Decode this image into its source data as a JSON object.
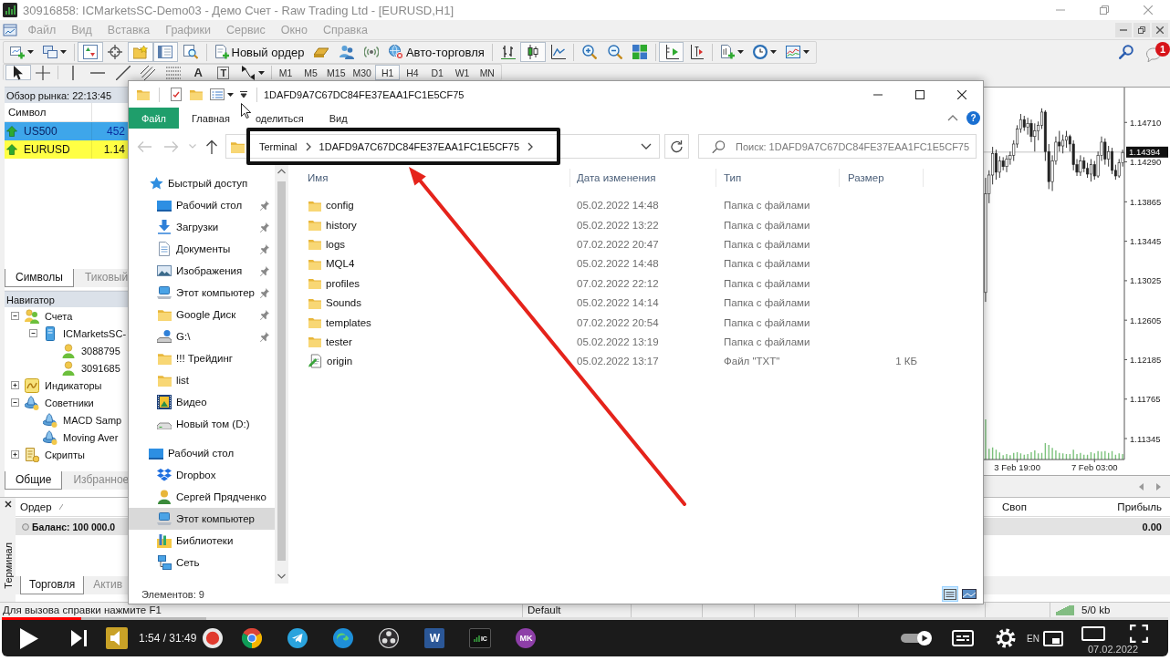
{
  "mt4": {
    "title": "30916858: ICMarketsSC-Demo03 - Демо Счет - Raw Trading Ltd - [EURUSD,H1]",
    "menu": [
      "Файл",
      "Вид",
      "Вставка",
      "Графики",
      "Сервис",
      "Окно",
      "Справка"
    ],
    "toolbar": {
      "groups": [
        [
          {
            "kind": "chart-plus",
            "pressed": false,
            "dropdown": true
          },
          {
            "kind": "windows",
            "pressed": false,
            "dropdown": true
          }
        ],
        [
          {
            "kind": "market-watch",
            "pressed": true,
            "dropdown": false
          },
          {
            "kind": "data-window",
            "pressed": false,
            "dropdown": false
          },
          {
            "kind": "navigator",
            "pressed": true,
            "dropdown": false
          },
          {
            "kind": "terminal",
            "pressed": true,
            "dropdown": false
          },
          {
            "kind": "tester",
            "pressed": false,
            "dropdown": false
          }
        ],
        [
          {
            "kind": "new-order",
            "label": "Новый ордер",
            "pressed": false,
            "dropdown": false
          },
          {
            "kind": "editor",
            "pressed": false,
            "dropdown": false
          },
          {
            "kind": "signals",
            "pressed": false,
            "dropdown": false
          },
          {
            "kind": "radio",
            "pressed": false,
            "dropdown": false
          },
          {
            "kind": "autotrading",
            "label": "Авто-торговля",
            "pressed": false,
            "dropdown": false
          }
        ],
        [
          {
            "kind": "bars",
            "pressed": false,
            "dropdown": false
          },
          {
            "kind": "candles",
            "pressed": true,
            "dropdown": false
          },
          {
            "kind": "line",
            "pressed": false,
            "dropdown": false
          }
        ],
        [
          {
            "kind": "zoom-in",
            "pressed": false,
            "dropdown": false
          },
          {
            "kind": "zoom-out",
            "pressed": false,
            "dropdown": false
          },
          {
            "kind": "tile",
            "pressed": false,
            "dropdown": false
          }
        ],
        [
          {
            "kind": "shift",
            "pressed": true,
            "dropdown": false
          },
          {
            "kind": "autoscroll",
            "pressed": false,
            "dropdown": false
          }
        ],
        [
          {
            "kind": "indicators",
            "pressed": false,
            "dropdown": true
          },
          {
            "kind": "periods",
            "pressed": false,
            "dropdown": true
          },
          {
            "kind": "templates",
            "pressed": false,
            "dropdown": true
          }
        ]
      ],
      "notifications": "1"
    },
    "drawing_toolbar": {
      "groups": [
        [
          {
            "kind": "cursor",
            "pressed": true,
            "dropdown": false
          },
          {
            "kind": "cross",
            "pressed": false,
            "dropdown": false
          }
        ],
        [
          {
            "kind": "vline",
            "pressed": false,
            "dropdown": false
          },
          {
            "kind": "hline",
            "pressed": false,
            "dropdown": false
          },
          {
            "kind": "trend",
            "pressed": false,
            "dropdown": false
          },
          {
            "kind": "channel",
            "pressed": false,
            "dropdown": false
          },
          {
            "kind": "fibo",
            "pressed": false,
            "dropdown": false
          },
          {
            "kind": "text",
            "label": "A",
            "pressed": false,
            "dropdown": false
          },
          {
            "kind": "label",
            "label": "T",
            "pressed": false,
            "dropdown": false
          },
          {
            "kind": "arrows",
            "pressed": false,
            "dropdown": true
          }
        ]
      ],
      "timeframes": [
        {
          "label": "M1",
          "selected": false
        },
        {
          "label": "M5",
          "selected": false
        },
        {
          "label": "M15",
          "selected": false
        },
        {
          "label": "M30",
          "selected": false
        },
        {
          "label": "H1",
          "selected": true
        },
        {
          "label": "H4",
          "selected": false
        },
        {
          "label": "D1",
          "selected": false
        },
        {
          "label": "W1",
          "selected": false
        },
        {
          "label": "MN",
          "selected": false
        }
      ]
    },
    "market_watch": {
      "title": "Обзор рынка: 22:13:45",
      "columns": [
        "Символ"
      ],
      "rows": [
        {
          "symbol": "US500",
          "bid": "452",
          "rising": true,
          "selected": true,
          "highlighted": false
        },
        {
          "symbol": "EURUSD",
          "bid": "1.14",
          "rising": true,
          "selected": false,
          "highlighted": true
        }
      ],
      "tabs": [
        {
          "label": "Символы",
          "selected": true
        },
        {
          "label": "Тиковый",
          "selected": false
        }
      ]
    },
    "navigator": {
      "title": "Навигатор",
      "tree": [
        {
          "label": "Счета",
          "kind": "accounts",
          "expanded": true,
          "children": [
            {
              "label": "ICMarketsSC-",
              "kind": "server",
              "expanded": true,
              "children": [
                {
                  "label": "3088795",
                  "kind": "account"
                },
                {
                  "label": "3091685",
                  "kind": "account"
                }
              ]
            }
          ]
        },
        {
          "label": "Индикаторы",
          "kind": "indicators",
          "expanded": false
        },
        {
          "label": "Советники",
          "kind": "experts",
          "expanded": true,
          "children": [
            {
              "label": "MACD Samp",
              "kind": "expert"
            },
            {
              "label": "Moving Aver",
              "kind": "expert"
            }
          ]
        },
        {
          "label": "Скрипты",
          "kind": "scripts",
          "expanded": false
        }
      ],
      "tabs": [
        {
          "label": "Общие",
          "selected": true
        },
        {
          "label": "Избранное",
          "selected": false
        }
      ]
    },
    "chart": {
      "chart_data": [
        {
          "type": "candlestick",
          "categories": [
            null,
            null,
            null,
            null,
            null,
            null,
            null,
            null,
            null,
            "3 Feb 19:00",
            null,
            null,
            null,
            null,
            null,
            null,
            null,
            null,
            null,
            null,
            null,
            null,
            null,
            null,
            null,
            null,
            null,
            null,
            null,
            null,
            null,
            "7 Feb 03:00",
            null,
            null,
            null,
            null,
            null,
            null,
            null,
            null
          ],
          "ohlc": [
            [
              1.129,
              1.1412,
              1.128,
              1.1395
            ],
            [
              1.1395,
              1.142,
              1.1385,
              1.1415
            ],
            [
              1.1415,
              1.1445,
              1.1405,
              1.1438
            ],
            [
              1.1438,
              1.1442,
              1.141,
              1.1418
            ],
            [
              1.1418,
              1.1435,
              1.1412,
              1.143
            ],
            [
              1.143,
              1.1434,
              1.142,
              1.1424
            ],
            [
              1.1424,
              1.1436,
              1.1418,
              1.1432
            ],
            [
              1.1432,
              1.144,
              1.1426,
              1.1436
            ],
            [
              1.1436,
              1.1452,
              1.143,
              1.1448
            ],
            [
              1.1448,
              1.1468,
              1.1444,
              1.1464
            ],
            [
              1.1464,
              1.148,
              1.146,
              1.1474
            ],
            [
              1.1474,
              1.1478,
              1.1462,
              1.1466
            ],
            [
              1.1466,
              1.1476,
              1.1458,
              1.147
            ],
            [
              1.147,
              1.1474,
              1.145,
              1.1456
            ],
            [
              1.1456,
              1.147,
              1.144,
              1.1462
            ],
            [
              1.1462,
              1.1472,
              1.1452,
              1.1468
            ],
            [
              1.1468,
              1.1486,
              1.1464,
              1.1482
            ],
            [
              1.1482,
              1.1484,
              1.143,
              1.144
            ],
            [
              1.144,
              1.1448,
              1.14,
              1.1408
            ],
            [
              1.1408,
              1.1436,
              1.1398,
              1.143
            ],
            [
              1.143,
              1.1456,
              1.1426,
              1.145
            ],
            [
              1.145,
              1.1462,
              1.144,
              1.1446
            ],
            [
              1.1446,
              1.1458,
              1.1438,
              1.1452
            ],
            [
              1.1452,
              1.1462,
              1.1444,
              1.1456
            ],
            [
              1.1456,
              1.1458,
              1.144,
              1.1448
            ],
            [
              1.1448,
              1.1452,
              1.142,
              1.1426
            ],
            [
              1.1426,
              1.1432,
              1.1414,
              1.1418
            ],
            [
              1.1418,
              1.1436,
              1.1414,
              1.143
            ],
            [
              1.143,
              1.1434,
              1.1418,
              1.1422
            ],
            [
              1.1422,
              1.1428,
              1.1412,
              1.1416
            ],
            [
              1.1416,
              1.1432,
              1.1408,
              1.1426
            ],
            [
              1.1426,
              1.143,
              1.141,
              1.1414
            ],
            [
              1.1414,
              1.144,
              1.1412,
              1.1436
            ],
            [
              1.1436,
              1.1456,
              1.143,
              1.145
            ],
            [
              1.145,
              1.1454,
              1.1426,
              1.1432
            ],
            [
              1.1432,
              1.1446,
              1.1424,
              1.144
            ],
            [
              1.144,
              1.1444,
              1.1416,
              1.142
            ],
            [
              1.142,
              1.1426,
              1.141,
              1.1414
            ],
            [
              1.1414,
              1.1432,
              1.1412,
              1.1428
            ],
            [
              1.1428,
              1.1442,
              1.1424,
              1.1439
            ]
          ],
          "ylim": [
            1.11122,
            1.15062
          ],
          "yticks": [
            {
              "value": 1.1471,
              "label": "1.14710"
            },
            {
              "value": 1.1429,
              "label": "1.14290"
            },
            {
              "value": 1.13865,
              "label": "1.13865"
            },
            {
              "value": 1.13445,
              "label": "1.13445"
            },
            {
              "value": 1.13025,
              "label": "1.13025"
            },
            {
              "value": 1.12605,
              "label": "1.12605"
            },
            {
              "value": 1.12185,
              "label": "1.12185"
            },
            {
              "value": 1.11765,
              "label": "1.11765"
            },
            {
              "value": 1.11345,
              "label": "1.11345"
            }
          ],
          "ref_lines": [
            {
              "axis": "y",
              "value": 1.14394,
              "label": "1.14394",
              "color": "#b4b4b4"
            }
          ]
        }
      ]
    },
    "terminal": {
      "title": "Терминал",
      "columns": [
        "Ордер",
        "Своп",
        "Прибыль"
      ],
      "balance": {
        "label": "Баланс: 100 000.0",
        "profit": "0.00"
      },
      "tabs": [
        {
          "label": "Торговля",
          "selected": true
        },
        {
          "label": "Актив",
          "selected": false
        }
      ]
    },
    "status_bar": {
      "help": "Для вызова справки нажмите F1",
      "profile": "Default",
      "traffic": "5/0 kb"
    }
  },
  "explorer": {
    "title": "1DAFD9A7C67DC84FE37EAA1FC1E5CF75",
    "ribbon": [
      {
        "kind": "menu",
        "label": "Файл"
      },
      {
        "kind": "tab",
        "label": "Главная"
      },
      {
        "kind": "tab",
        "label": "оделиться"
      },
      {
        "kind": "tab",
        "label": "Вид"
      }
    ],
    "help": "?",
    "nav_buttons": [
      {
        "kind": "back",
        "disabled": true
      },
      {
        "kind": "forward",
        "disabled": true
      },
      {
        "kind": "recent",
        "disabled": true
      },
      {
        "kind": "up",
        "disabled": false
      }
    ],
    "address": [
      "Terminal",
      "1DAFD9A7C67DC84FE37EAA1FC1E5CF75"
    ],
    "search": {
      "placeholder": "Поиск: 1DAFD9A7C67DC84FE37EAA1FC1E5CF75"
    },
    "nav": [
      {
        "label": "Быстрый доступ",
        "kind": "star",
        "selected": false,
        "children": [
          {
            "label": "Рабочий стол",
            "kind": "desktop",
            "pinned": true,
            "selected": false
          },
          {
            "label": "Загрузки",
            "kind": "downloads",
            "pinned": true,
            "selected": false
          },
          {
            "label": "Документы",
            "kind": "documents",
            "pinned": true,
            "selected": false
          },
          {
            "label": "Изображения",
            "kind": "pictures",
            "pinned": true,
            "selected": false
          },
          {
            "label": "Этот компьютер",
            "kind": "computer",
            "pinned": true,
            "selected": false
          },
          {
            "label": "Google Диск",
            "kind": "folder",
            "pinned": true,
            "selected": false
          },
          {
            "label": "G:\\",
            "kind": "drive-unknown",
            "pinned": true,
            "selected": false
          },
          {
            "label": "!!! Трейдинг",
            "kind": "folder",
            "pinned": false,
            "selected": false
          },
          {
            "label": "list",
            "kind": "folder",
            "pinned": false,
            "selected": false
          },
          {
            "label": "Видео",
            "kind": "videos",
            "pinned": false,
            "selected": false
          },
          {
            "label": "Новый том (D:)",
            "kind": "drive",
            "pinned": false,
            "selected": false
          }
        ]
      },
      {
        "label": "Рабочий стол",
        "kind": "desktop",
        "selected": false,
        "children": [
          {
            "label": "Dropbox",
            "kind": "dropbox",
            "selected": false
          },
          {
            "label": "Сергей Прядченко",
            "kind": "user",
            "selected": false
          },
          {
            "label": "Этот компьютер",
            "kind": "computer",
            "selected": true
          },
          {
            "label": "Библиотеки",
            "kind": "libraries",
            "selected": false
          },
          {
            "label": "Сеть",
            "kind": "network",
            "selected": false
          }
        ]
      }
    ],
    "columns": [
      "Имя",
      "Дата изменения",
      "Тип",
      "Размер"
    ],
    "files": [
      {
        "kind": "folder",
        "name": "config",
        "modified": "05.02.2022 14:48",
        "type": "Папка с файлами"
      },
      {
        "kind": "folder",
        "name": "history",
        "modified": "05.02.2022 13:22",
        "type": "Папка с файлами"
      },
      {
        "kind": "folder",
        "name": "logs",
        "modified": "07.02.2022 20:47",
        "type": "Папка с файлами"
      },
      {
        "kind": "folder",
        "name": "MQL4",
        "modified": "05.02.2022 14:48",
        "type": "Папка с файлами"
      },
      {
        "kind": "folder",
        "name": "profiles",
        "modified": "07.02.2022 22:12",
        "type": "Папка с файлами"
      },
      {
        "kind": "folder",
        "name": "Sounds",
        "modified": "05.02.2022 14:14",
        "type": "Папка с файлами"
      },
      {
        "kind": "folder",
        "name": "templates",
        "modified": "07.02.2022 20:54",
        "type": "Папка с файлами"
      },
      {
        "kind": "folder",
        "name": "tester",
        "modified": "05.02.2022 13:19",
        "type": "Папка с файлами"
      },
      {
        "kind": "text-file",
        "name": "origin",
        "modified": "05.02.2022 13:17",
        "type": "Файл \"TXT\"",
        "size": "1 КБ"
      }
    ],
    "status": "Элементов: 9",
    "views": [
      {
        "kind": "details",
        "selected": true
      },
      {
        "kind": "tiles",
        "selected": false
      }
    ]
  },
  "player": {
    "time": "1:54 / 31:49",
    "progress": {
      "level": 0.068
    },
    "buffered": {
      "level": 0.175
    },
    "autoplay": true
  },
  "taskbar": {
    "apps": [
      {
        "kind": "browser"
      },
      {
        "kind": "chrome"
      },
      {
        "kind": "telegram"
      },
      {
        "kind": "edge"
      },
      {
        "kind": "obs"
      },
      {
        "kind": "word",
        "label": "W"
      },
      {
        "kind": "terminal",
        "label": "IC"
      },
      {
        "kind": "initials",
        "label": "MK"
      }
    ],
    "language": "EN",
    "date": "07.02.2022"
  }
}
